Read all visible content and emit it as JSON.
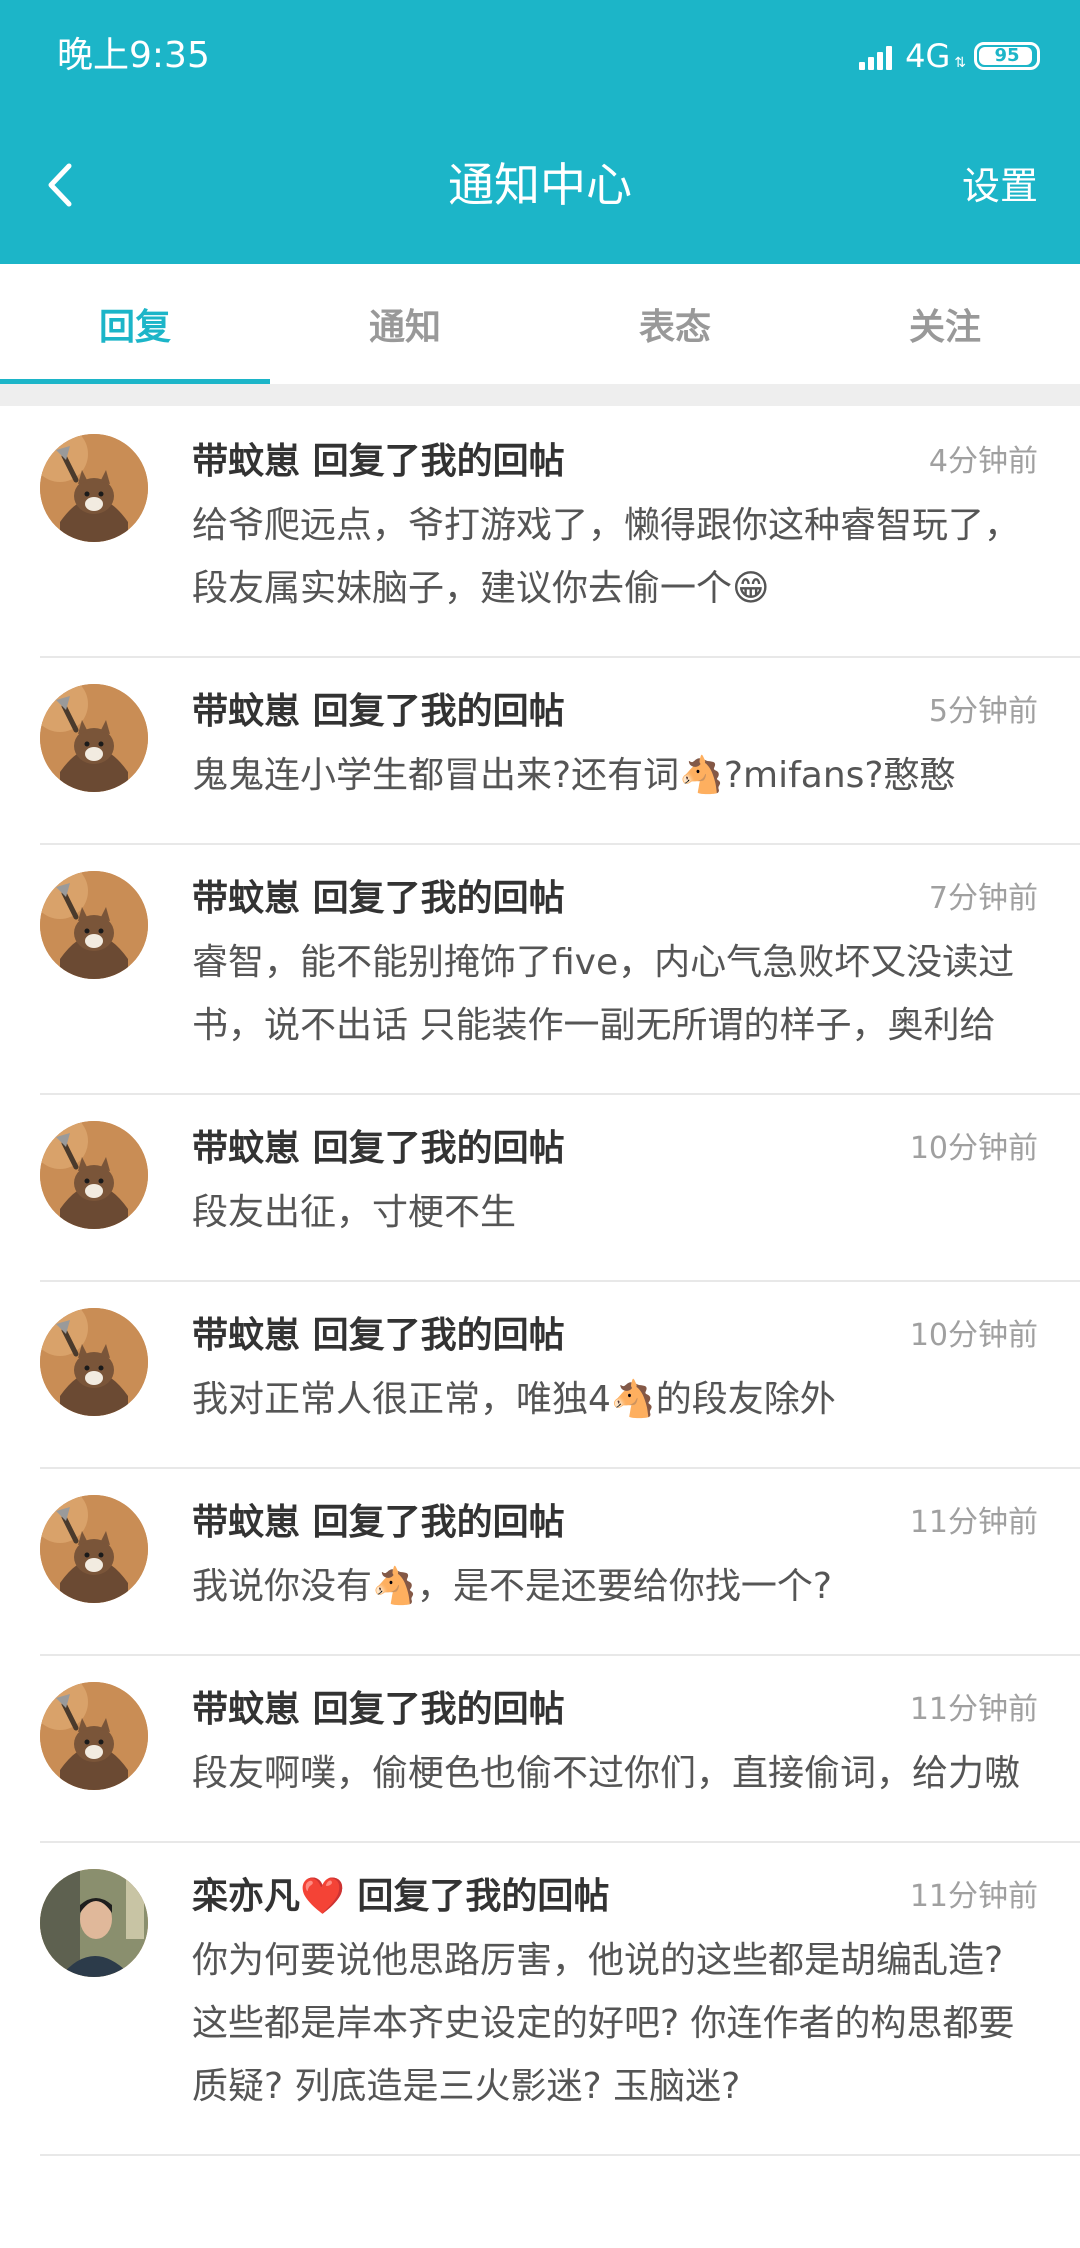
{
  "status_bar": {
    "time": "晚上9:35",
    "network": "4G",
    "battery": "95"
  },
  "nav": {
    "title": "通知中心",
    "settings": "设置"
  },
  "tabs": [
    {
      "label": "回复",
      "active": true
    },
    {
      "label": "通知",
      "active": false
    },
    {
      "label": "表态",
      "active": false
    },
    {
      "label": "关注",
      "active": false
    }
  ],
  "items": [
    {
      "user": "带蚊崽",
      "action": "回复了我的回帖",
      "time": "4分钟前",
      "text": "给爷爬远点，爷打游戏了，懒得跟你这种睿智玩了，段友属实妹脑子，建议你去偷一个😁",
      "avatar": "cat-avatar"
    },
    {
      "user": "带蚊崽",
      "action": "回复了我的回帖",
      "time": "5分钟前",
      "text": "鬼鬼连小学生都冒出来?还有词🐴?mifans?憨憨",
      "avatar": "cat-avatar"
    },
    {
      "user": "带蚊崽",
      "action": "回复了我的回帖",
      "time": "7分钟前",
      "text": "睿智，能不能别掩饰了five，内心气急败坏又没读过书，说不出话 只能装作一副无所谓的样子，奥利给",
      "avatar": "cat-avatar"
    },
    {
      "user": "带蚊崽",
      "action": "回复了我的回帖",
      "time": "10分钟前",
      "text": "段友出征，寸梗不生",
      "avatar": "cat-avatar"
    },
    {
      "user": "带蚊崽",
      "action": "回复了我的回帖",
      "time": "10分钟前",
      "text": "我对正常人很正常，唯独4🐴的段友除外",
      "avatar": "cat-avatar"
    },
    {
      "user": "带蚊崽",
      "action": "回复了我的回帖",
      "time": "11分钟前",
      "text": "我说你没有🐴，是不是还要给你找一个?",
      "avatar": "cat-avatar"
    },
    {
      "user": "带蚊崽",
      "action": "回复了我的回帖",
      "time": "11分钟前",
      "text": "段友啊噗，偷梗色也偷不过你们，直接偷词，给力嗷",
      "avatar": "cat-avatar"
    },
    {
      "user": "栾亦凡❤️",
      "action": "回复了我的回帖",
      "time": "11分钟前",
      "text": "你为何要说他思路厉害，他说的这些都是胡编乱造? 这些都是岸本齐史设定的好吧? 你连作者的构思都要质疑? 列底造是三火影迷? 玉脑迷?",
      "avatar": "person-avatar"
    }
  ],
  "colors": {
    "accent": "#1cb5c8",
    "time": "#a0a0a0",
    "divider": "#e8e8e8"
  }
}
